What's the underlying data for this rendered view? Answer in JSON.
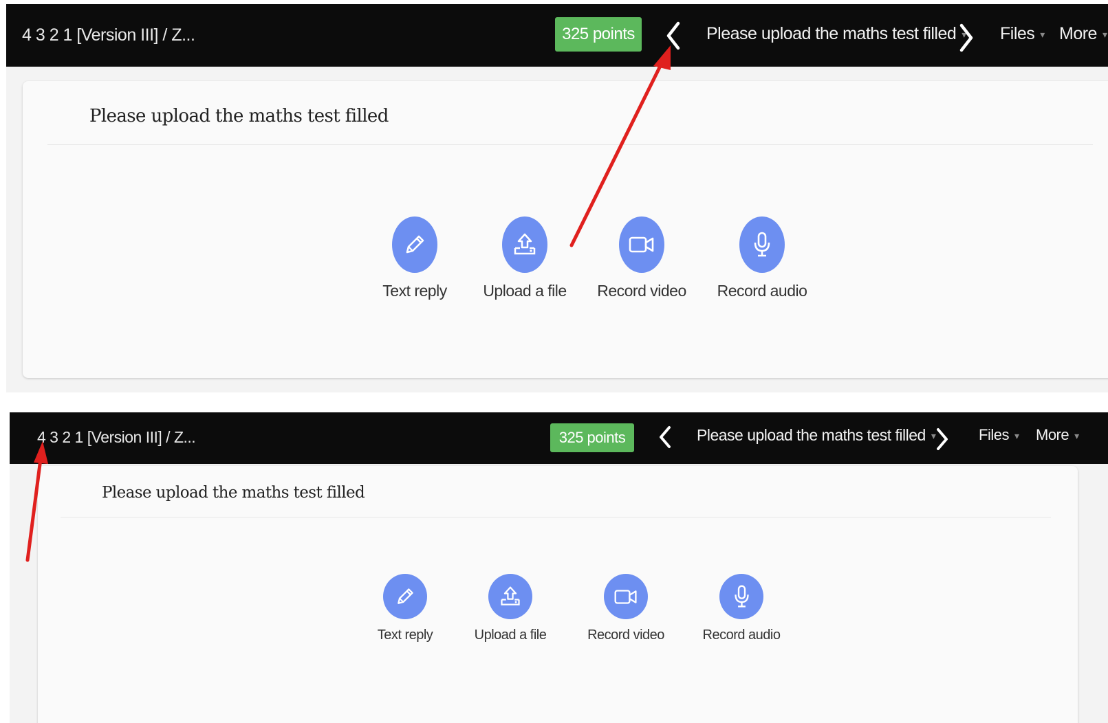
{
  "accent_colors": {
    "topbar": "#0c0c0c",
    "points_badge": "#5cb85c",
    "option_circle": "#6d8ff1",
    "annotation_arrow": "#e0201e"
  },
  "screens": [
    {
      "breadcrumb": "4 3 2 1 [Version III] / Z...",
      "points": "325 points",
      "prev_icon": "chevron-left-icon",
      "next_icon": "chevron-right-icon",
      "task_selector": "Please upload the maths test filled",
      "files_menu": "Files",
      "more_menu": "More",
      "task_title": "Please upload the maths test filled",
      "reply_options": [
        {
          "label": "Text reply",
          "icon": "pencil-icon"
        },
        {
          "label": "Upload a file",
          "icon": "upload-icon"
        },
        {
          "label": "Record video",
          "icon": "video-camera-icon"
        },
        {
          "label": "Record audio",
          "icon": "microphone-icon"
        }
      ],
      "annotation": "red arrow pointing to the previous-task chevron"
    },
    {
      "breadcrumb": "4 3 2 1 [Version III] / Z...",
      "points": "325 points",
      "prev_icon": "chevron-left-icon",
      "next_icon": "chevron-right-icon",
      "task_selector": "Please upload the maths test filled",
      "files_menu": "Files",
      "more_menu": "More",
      "task_title": "Please upload the maths test filled",
      "reply_options": [
        {
          "label": "Text reply",
          "icon": "pencil-icon"
        },
        {
          "label": "Upload a file",
          "icon": "upload-icon"
        },
        {
          "label": "Record video",
          "icon": "video-camera-icon"
        },
        {
          "label": "Record audio",
          "icon": "microphone-icon"
        }
      ],
      "annotation": "red arrow pointing to the breadcrumb"
    }
  ]
}
